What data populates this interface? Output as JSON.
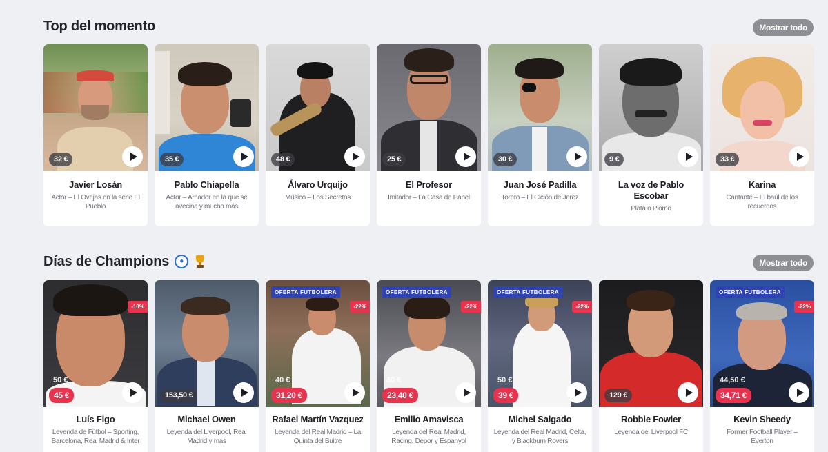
{
  "sections": [
    {
      "title": "Top del momento",
      "show_all": "Mostrar todo",
      "cards": [
        {
          "name": "Javier Losán",
          "desc": "Actor – El Ovejas en la serie El Pueblo",
          "price": "32 €"
        },
        {
          "name": "Pablo Chiapella",
          "desc": "Actor – Amador en la que se avecina y mucho más",
          "price": "35 €"
        },
        {
          "name": "Álvaro Urquijo",
          "desc": "Músico – Los Secretos",
          "price": "48 €"
        },
        {
          "name": "El Profesor",
          "desc": "Imitador – La Casa de Papel",
          "price": "25 €"
        },
        {
          "name": "Juan José Padilla",
          "desc": "Torero – El Ciclón de Jerez",
          "price": "30 €"
        },
        {
          "name": "La voz de Pablo Escobar",
          "desc": "Plata o Plomo",
          "price": "9 €"
        },
        {
          "name": "Karina",
          "desc": "Cantante – El baúl de los recuerdos",
          "price": "33 €"
        }
      ]
    },
    {
      "title": "Días de Champions",
      "show_all": "Mostrar todo",
      "cards": [
        {
          "name": "Luís Figo",
          "desc": "Leyenda de Fútbol – Sporting, Barcelona, Real Madrid & Inter",
          "price": "45 €",
          "old_price": "50 €",
          "discount": "-10%",
          "offer": ""
        },
        {
          "name": "Michael Owen",
          "desc": "Leyenda del Liverpool, Real Madrid y más",
          "price": "153,50 €",
          "old_price": "",
          "discount": "",
          "offer": ""
        },
        {
          "name": "Rafael Martín Vazquez",
          "desc": "Leyenda del Real Madrid – La Quinta del Buitre",
          "price": "31,20 €",
          "old_price": "40 €",
          "discount": "-22%",
          "offer": "OFERTA FUTBOLERA"
        },
        {
          "name": "Emilio Amavisca",
          "desc": "Leyenda del Real Madrid, Racing, Depor y Espanyol",
          "price": "23,40 €",
          "old_price": "30 €",
          "discount": "-22%",
          "offer": "OFERTA FUTBOLERA"
        },
        {
          "name": "Michel Salgado",
          "desc": "Leyenda del Real Madrid, Celta, y Blackburn Rovers",
          "price": "39 €",
          "old_price": "50 €",
          "discount": "-22%",
          "offer": "OFERTA FUTBOLERA"
        },
        {
          "name": "Robbie Fowler",
          "desc": "Leyenda del Liverpool FC",
          "price": "129 €",
          "old_price": "",
          "discount": "",
          "offer": ""
        },
        {
          "name": "Kevin Sheedy",
          "desc": "Former Football Player – Everton",
          "price": "34,71 €",
          "old_price": "44,50 €",
          "discount": "-22%",
          "offer": "OFERTA FUTBOLERA"
        }
      ]
    }
  ],
  "colors": {
    "accent": "#e8334f",
    "offer_badge": "#2f43b5",
    "pill": "#8d8f95",
    "background": "#eff0f4"
  },
  "icons": {
    "play": "play-icon",
    "ball": "soccer-ball-icon",
    "trophy": "trophy-icon"
  }
}
